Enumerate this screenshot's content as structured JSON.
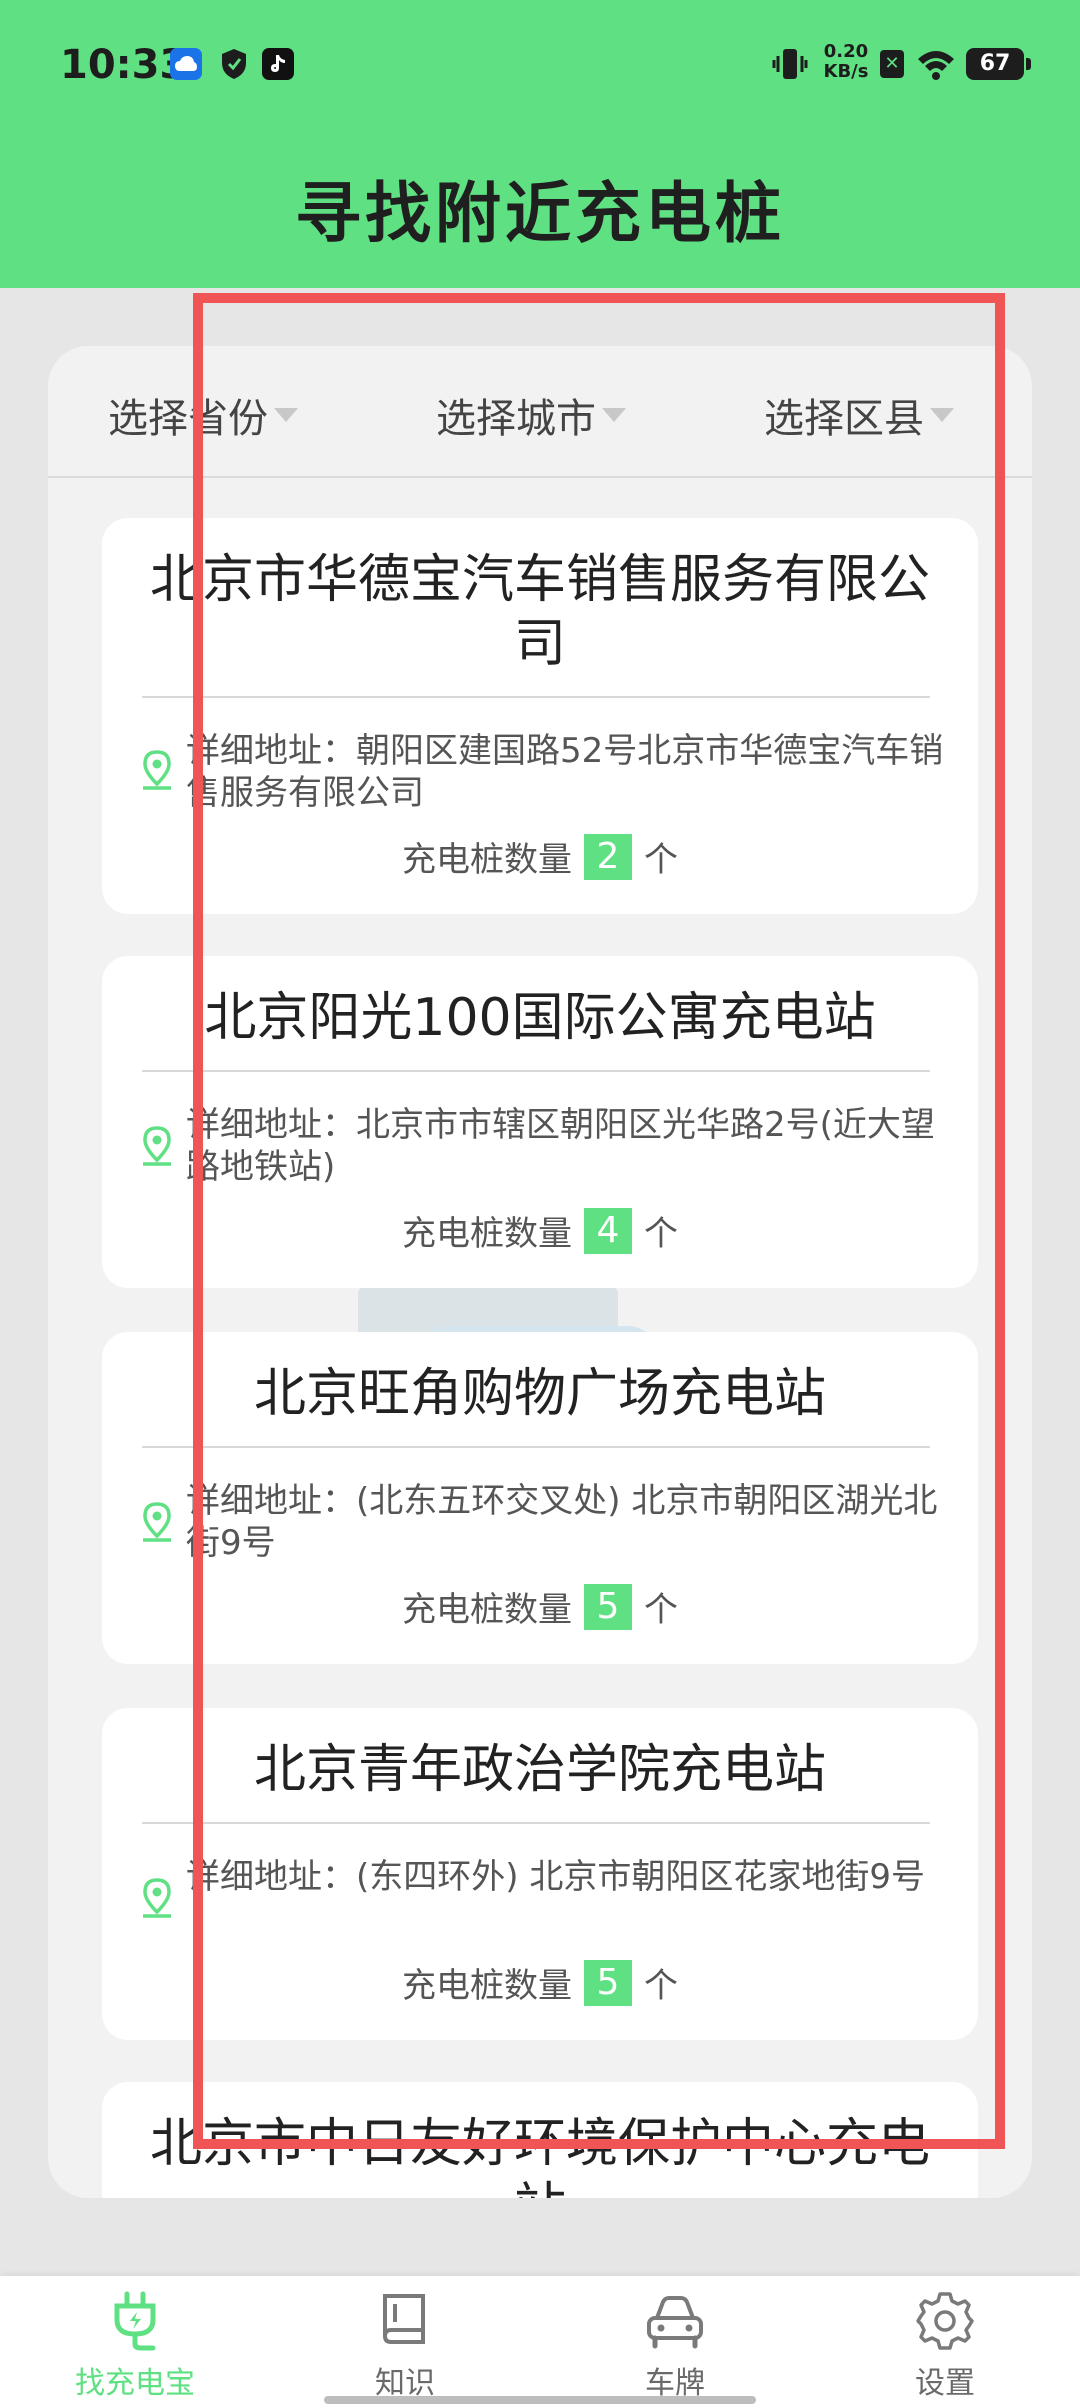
{
  "status_bar": {
    "time": "10:33",
    "net_speed_value": "0.20",
    "net_speed_unit": "KB/s",
    "battery": "67"
  },
  "header": {
    "title": "寻找附近充电桩"
  },
  "filters": {
    "province": "选择省份",
    "city": "选择城市",
    "district": "选择区县"
  },
  "stations": [
    {
      "name": "北京市华德宝汽车销售服务有限公司",
      "address": "详细地址：朝阳区建国路52号北京市华德宝汽车销售服务有限公司",
      "count_label": "充电桩数量",
      "count": "2",
      "unit": "个"
    },
    {
      "name": "北京阳光100国际公寓充电站",
      "address": "详细地址：北京市市辖区朝阳区光华路2号(近大望路地铁站)",
      "count_label": "充电桩数量",
      "count": "4",
      "unit": "个"
    },
    {
      "name": "北京旺角购物广场充电站",
      "address": "详细地址：(北东五环交叉处) 北京市朝阳区湖光北街9号",
      "count_label": "充电桩数量",
      "count": "5",
      "unit": "个"
    },
    {
      "name": "北京青年政治学院充电站",
      "address": "详细地址：(东四环外) 北京市朝阳区花家地街9号",
      "count_label": "充电桩数量",
      "count": "5",
      "unit": "个"
    },
    {
      "name": "北京市中日友好环境保护中心充电站"
    }
  ],
  "bottom_nav": [
    {
      "label": "找充电宝",
      "icon": "plug-icon",
      "active": true
    },
    {
      "label": "知识",
      "icon": "book-icon",
      "active": false
    },
    {
      "label": "车牌",
      "icon": "car-icon",
      "active": false
    },
    {
      "label": "设置",
      "icon": "gear-icon",
      "active": false
    }
  ],
  "colors": {
    "accent": "#5fe082",
    "highlight": "#f05454"
  }
}
